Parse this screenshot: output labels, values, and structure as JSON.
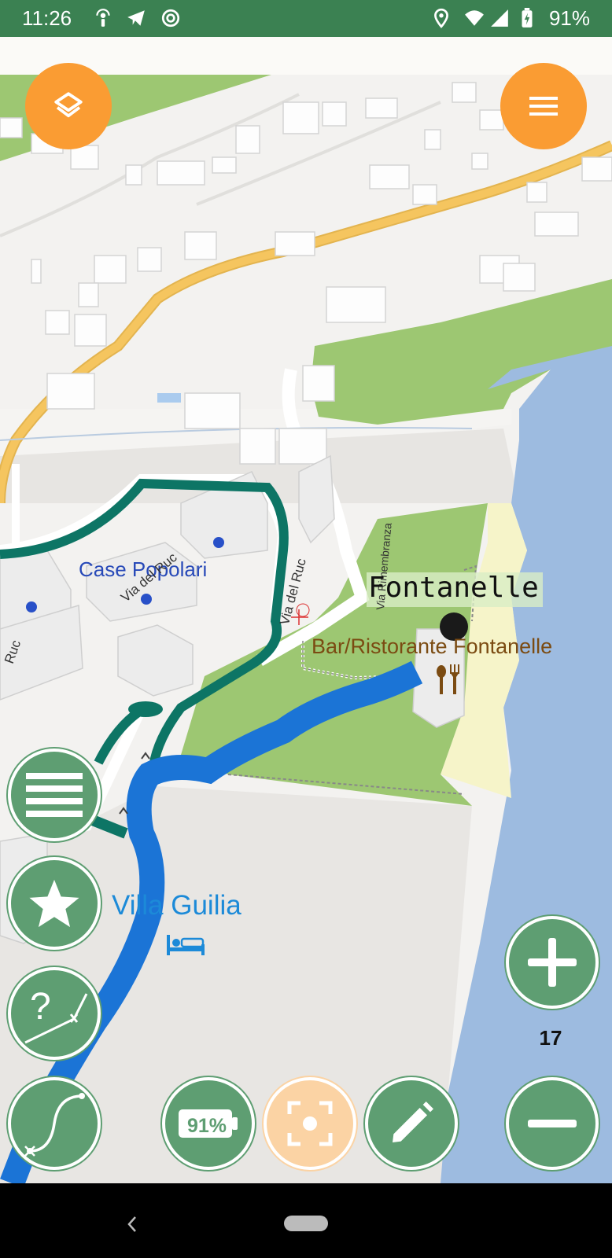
{
  "status_bar": {
    "time": "11:26",
    "battery": "91%",
    "icons": [
      "podcast-icon",
      "telegram-icon",
      "at-icon",
      "location-icon",
      "wifi-icon",
      "signal-icon",
      "battery-icon"
    ]
  },
  "map": {
    "labels": {
      "case_popolari": "Case Popolari",
      "via_del_ruc_1": "Via del Ruc",
      "via_del_ruc_2": "Via del Ruc",
      "via_rimembranza": "Via Rimembranza",
      "ruc": "Ruc",
      "fontanelle": "Fontanelle",
      "bar_ristorante": "Bar/Ristorante Fontanelle",
      "villa_guilia": "Villa Guilia"
    },
    "zoom_level": "17",
    "colors": {
      "water": "#9dbbe0",
      "grass": "#9dc772",
      "route_blue": "#1b74d6",
      "track_teal": "#0d7565",
      "road_yellow": "#f5c55f"
    }
  },
  "controls": {
    "battery_button_label": "91%"
  }
}
